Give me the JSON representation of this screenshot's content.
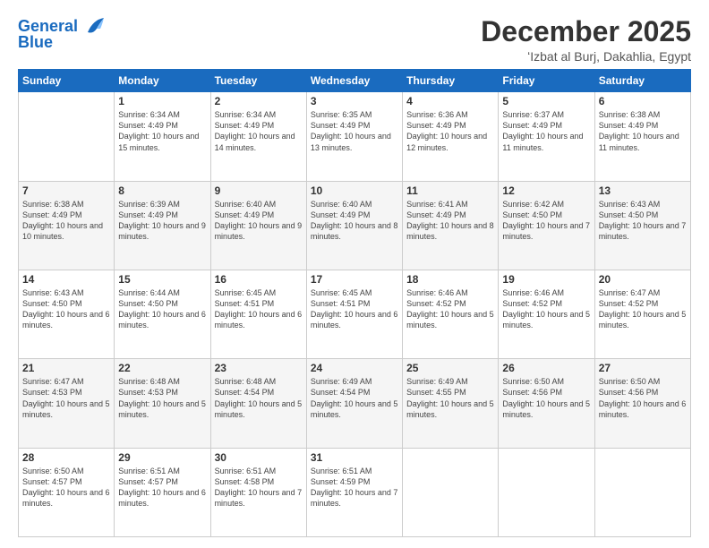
{
  "logo": {
    "text_general": "General",
    "text_blue": "Blue"
  },
  "header": {
    "month": "December 2025",
    "location": "ʻIzbat al Burj, Dakahlia, Egypt"
  },
  "weekdays": [
    "Sunday",
    "Monday",
    "Tuesday",
    "Wednesday",
    "Thursday",
    "Friday",
    "Saturday"
  ],
  "weeks": [
    [
      {
        "day": "",
        "sunrise": "",
        "sunset": "",
        "daylight": "",
        "empty": true
      },
      {
        "day": "1",
        "sunrise": "Sunrise: 6:34 AM",
        "sunset": "Sunset: 4:49 PM",
        "daylight": "Daylight: 10 hours and 15 minutes."
      },
      {
        "day": "2",
        "sunrise": "Sunrise: 6:34 AM",
        "sunset": "Sunset: 4:49 PM",
        "daylight": "Daylight: 10 hours and 14 minutes."
      },
      {
        "day": "3",
        "sunrise": "Sunrise: 6:35 AM",
        "sunset": "Sunset: 4:49 PM",
        "daylight": "Daylight: 10 hours and 13 minutes."
      },
      {
        "day": "4",
        "sunrise": "Sunrise: 6:36 AM",
        "sunset": "Sunset: 4:49 PM",
        "daylight": "Daylight: 10 hours and 12 minutes."
      },
      {
        "day": "5",
        "sunrise": "Sunrise: 6:37 AM",
        "sunset": "Sunset: 4:49 PM",
        "daylight": "Daylight: 10 hours and 11 minutes."
      },
      {
        "day": "6",
        "sunrise": "Sunrise: 6:38 AM",
        "sunset": "Sunset: 4:49 PM",
        "daylight": "Daylight: 10 hours and 11 minutes."
      }
    ],
    [
      {
        "day": "7",
        "sunrise": "Sunrise: 6:38 AM",
        "sunset": "Sunset: 4:49 PM",
        "daylight": "Daylight: 10 hours and 10 minutes."
      },
      {
        "day": "8",
        "sunrise": "Sunrise: 6:39 AM",
        "sunset": "Sunset: 4:49 PM",
        "daylight": "Daylight: 10 hours and 9 minutes."
      },
      {
        "day": "9",
        "sunrise": "Sunrise: 6:40 AM",
        "sunset": "Sunset: 4:49 PM",
        "daylight": "Daylight: 10 hours and 9 minutes."
      },
      {
        "day": "10",
        "sunrise": "Sunrise: 6:40 AM",
        "sunset": "Sunset: 4:49 PM",
        "daylight": "Daylight: 10 hours and 8 minutes."
      },
      {
        "day": "11",
        "sunrise": "Sunrise: 6:41 AM",
        "sunset": "Sunset: 4:49 PM",
        "daylight": "Daylight: 10 hours and 8 minutes."
      },
      {
        "day": "12",
        "sunrise": "Sunrise: 6:42 AM",
        "sunset": "Sunset: 4:50 PM",
        "daylight": "Daylight: 10 hours and 7 minutes."
      },
      {
        "day": "13",
        "sunrise": "Sunrise: 6:43 AM",
        "sunset": "Sunset: 4:50 PM",
        "daylight": "Daylight: 10 hours and 7 minutes."
      }
    ],
    [
      {
        "day": "14",
        "sunrise": "Sunrise: 6:43 AM",
        "sunset": "Sunset: 4:50 PM",
        "daylight": "Daylight: 10 hours and 6 minutes."
      },
      {
        "day": "15",
        "sunrise": "Sunrise: 6:44 AM",
        "sunset": "Sunset: 4:50 PM",
        "daylight": "Daylight: 10 hours and 6 minutes."
      },
      {
        "day": "16",
        "sunrise": "Sunrise: 6:45 AM",
        "sunset": "Sunset: 4:51 PM",
        "daylight": "Daylight: 10 hours and 6 minutes."
      },
      {
        "day": "17",
        "sunrise": "Sunrise: 6:45 AM",
        "sunset": "Sunset: 4:51 PM",
        "daylight": "Daylight: 10 hours and 6 minutes."
      },
      {
        "day": "18",
        "sunrise": "Sunrise: 6:46 AM",
        "sunset": "Sunset: 4:52 PM",
        "daylight": "Daylight: 10 hours and 5 minutes."
      },
      {
        "day": "19",
        "sunrise": "Sunrise: 6:46 AM",
        "sunset": "Sunset: 4:52 PM",
        "daylight": "Daylight: 10 hours and 5 minutes."
      },
      {
        "day": "20",
        "sunrise": "Sunrise: 6:47 AM",
        "sunset": "Sunset: 4:52 PM",
        "daylight": "Daylight: 10 hours and 5 minutes."
      }
    ],
    [
      {
        "day": "21",
        "sunrise": "Sunrise: 6:47 AM",
        "sunset": "Sunset: 4:53 PM",
        "daylight": "Daylight: 10 hours and 5 minutes."
      },
      {
        "day": "22",
        "sunrise": "Sunrise: 6:48 AM",
        "sunset": "Sunset: 4:53 PM",
        "daylight": "Daylight: 10 hours and 5 minutes."
      },
      {
        "day": "23",
        "sunrise": "Sunrise: 6:48 AM",
        "sunset": "Sunset: 4:54 PM",
        "daylight": "Daylight: 10 hours and 5 minutes."
      },
      {
        "day": "24",
        "sunrise": "Sunrise: 6:49 AM",
        "sunset": "Sunset: 4:54 PM",
        "daylight": "Daylight: 10 hours and 5 minutes."
      },
      {
        "day": "25",
        "sunrise": "Sunrise: 6:49 AM",
        "sunset": "Sunset: 4:55 PM",
        "daylight": "Daylight: 10 hours and 5 minutes."
      },
      {
        "day": "26",
        "sunrise": "Sunrise: 6:50 AM",
        "sunset": "Sunset: 4:56 PM",
        "daylight": "Daylight: 10 hours and 5 minutes."
      },
      {
        "day": "27",
        "sunrise": "Sunrise: 6:50 AM",
        "sunset": "Sunset: 4:56 PM",
        "daylight": "Daylight: 10 hours and 6 minutes."
      }
    ],
    [
      {
        "day": "28",
        "sunrise": "Sunrise: 6:50 AM",
        "sunset": "Sunset: 4:57 PM",
        "daylight": "Daylight: 10 hours and 6 minutes."
      },
      {
        "day": "29",
        "sunrise": "Sunrise: 6:51 AM",
        "sunset": "Sunset: 4:57 PM",
        "daylight": "Daylight: 10 hours and 6 minutes."
      },
      {
        "day": "30",
        "sunrise": "Sunrise: 6:51 AM",
        "sunset": "Sunset: 4:58 PM",
        "daylight": "Daylight: 10 hours and 7 minutes."
      },
      {
        "day": "31",
        "sunrise": "Sunrise: 6:51 AM",
        "sunset": "Sunset: 4:59 PM",
        "daylight": "Daylight: 10 hours and 7 minutes."
      },
      {
        "day": "",
        "empty": true
      },
      {
        "day": "",
        "empty": true
      },
      {
        "day": "",
        "empty": true
      }
    ]
  ]
}
